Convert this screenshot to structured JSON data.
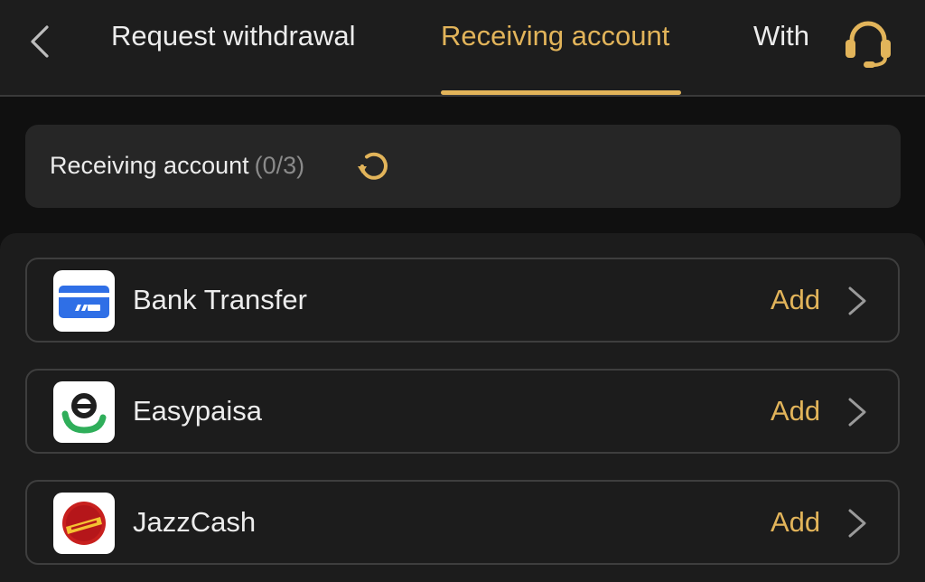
{
  "header": {
    "tabs": [
      {
        "label": "Request withdrawal",
        "active": false
      },
      {
        "label": "Receiving account",
        "active": true
      },
      {
        "label": "With",
        "active": false
      }
    ]
  },
  "summary": {
    "label": "Receiving account",
    "count": "(0/3)"
  },
  "methods": [
    {
      "name": "Bank Transfer",
      "action": "Add",
      "icon": "bank-card-icon"
    },
    {
      "name": "Easypaisa",
      "action": "Add",
      "icon": "easypaisa-logo"
    },
    {
      "name": "JazzCash",
      "action": "Add",
      "icon": "jazzcash-logo"
    }
  ],
  "colors": {
    "accent": "#e2b45a",
    "background": "#101010",
    "header": "#1d1d1d",
    "card": "#262626",
    "text": "#ececec",
    "muted": "#8a8a8a"
  }
}
